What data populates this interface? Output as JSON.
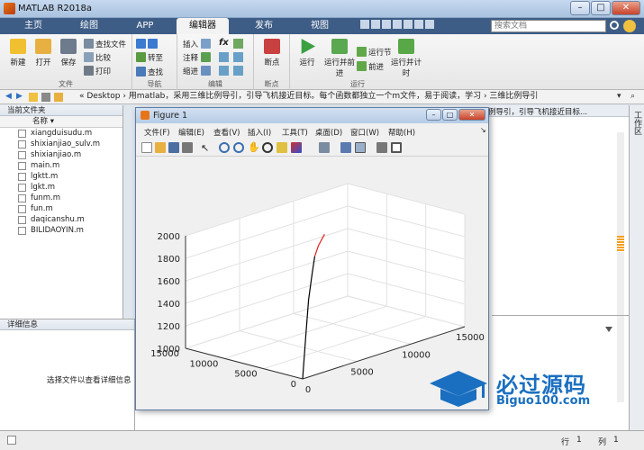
{
  "app": {
    "title": "MATLAB R2018a"
  },
  "window_controls": {
    "minimize": "–",
    "maximize": "□",
    "close": "✕"
  },
  "tabs": [
    "主页",
    "绘图",
    "APP",
    "编辑器",
    "发布",
    "视图"
  ],
  "search": {
    "placeholder": "搜索文档"
  },
  "ribbon": {
    "file": {
      "label": "文件",
      "new": "新建",
      "open": "打开",
      "save": "保存",
      "find_files": "查找文件",
      "compare": "比较",
      "print": "打印"
    },
    "nav": {
      "label": "导航",
      "goto": "转至",
      "find": "查找"
    },
    "edit": {
      "label": "编辑",
      "insert": "插入",
      "comment": "注释",
      "indent": "缩进",
      "fx": "fx"
    },
    "breakpoints": {
      "label": "断点",
      "breakpoints": "断点"
    },
    "run": {
      "label": "运行",
      "run": "运行",
      "run_advance": "运行并前进",
      "run_section": "运行节",
      "advance": "前进",
      "run_time": "运行并计时"
    }
  },
  "address": {
    "path": "« Desktop › 用matlab，采用三维比例导引，引导飞机接近目标。每个函数都独立一个m文件，易于阅读，学习 › 三维比例导引"
  },
  "editor_tab_overflow": "例导引，引导飞机接近目标...",
  "file_panel": {
    "title": "当前文件夹",
    "col_name": "名称",
    "files": [
      "xiangduisudu.m",
      "shixianjiao_sulv.m",
      "shixianjiao.m",
      "main.m",
      "lgktt.m",
      "lgkt.m",
      "funm.m",
      "fun.m",
      "daqicanshu.m",
      "BILIDAOYIN.m"
    ]
  },
  "detail_panel": {
    "title": "详细信息",
    "placeholder": "选择文件以查看详细信息"
  },
  "workspace": {
    "label": "工作区"
  },
  "status": {
    "row_label": "行",
    "row": "1",
    "col_label": "列",
    "col": "1"
  },
  "figure": {
    "title": "Figure 1",
    "menus": [
      "文件(F)",
      "编辑(E)",
      "查看(V)",
      "插入(I)",
      "工具(T)",
      "桌面(D)",
      "窗口(W)",
      "帮助(H)"
    ]
  },
  "chart_data": {
    "type": "line3d",
    "title": "",
    "zticks": [
      "2000",
      "1800",
      "1600",
      "1400",
      "1200",
      "1000"
    ],
    "xticks": [
      "0",
      "5000",
      "10000",
      "15000"
    ],
    "yticks": [
      "15000",
      "10000",
      "5000",
      "0"
    ],
    "zlim": [
      1000,
      2000
    ],
    "series": [
      {
        "color": "#000000",
        "points": [
          [
            0,
            0,
            1000
          ],
          [
            500,
            300,
            1350
          ],
          [
            1200,
            900,
            1650
          ],
          [
            2200,
            1800,
            1850
          ],
          [
            3000,
            2600,
            1950
          ]
        ]
      },
      {
        "color": "#e02020",
        "points": [
          [
            3000,
            2600,
            1950
          ],
          [
            4200,
            3800,
            1985
          ],
          [
            6000,
            5500,
            2000
          ]
        ]
      }
    ],
    "grid": true
  },
  "watermark": {
    "brand": "必过源码",
    "url": "Biguo100.com"
  }
}
